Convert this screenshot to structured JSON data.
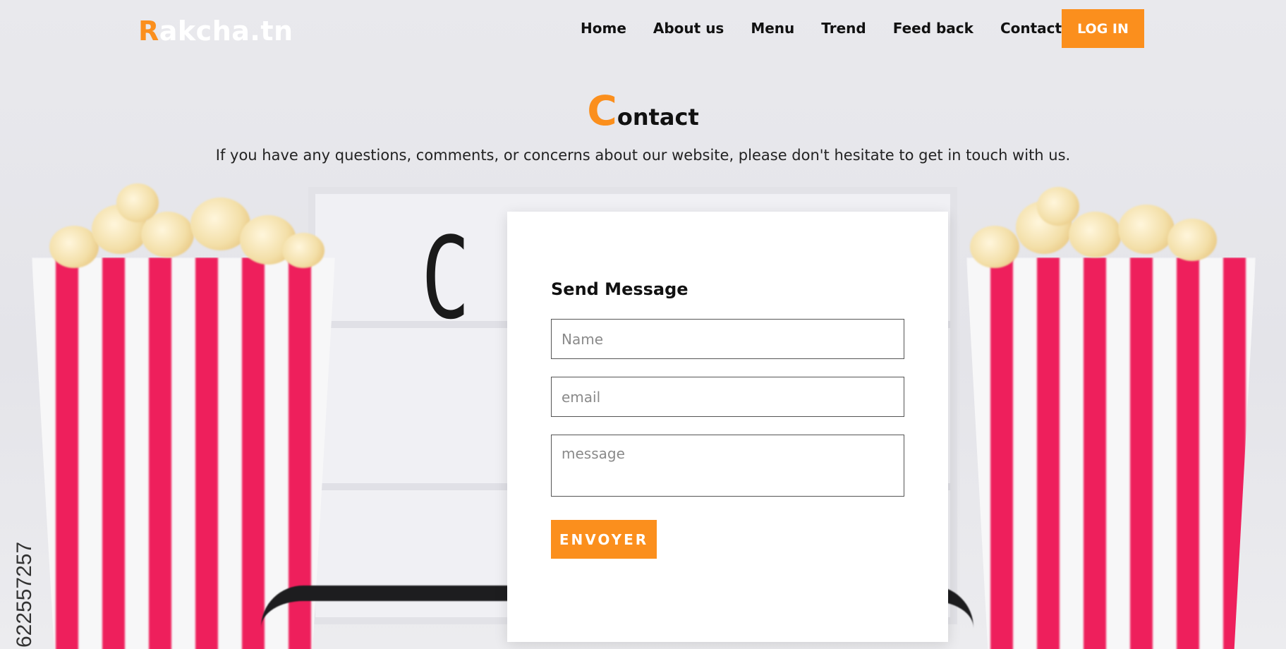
{
  "header": {
    "logo_first_letter": "R",
    "logo_rest": "akcha.tn",
    "nav": [
      {
        "label": "Home"
      },
      {
        "label": "About us"
      },
      {
        "label": "Menu"
      },
      {
        "label": "Trend"
      },
      {
        "label": "Feed back"
      },
      {
        "label": "Contact"
      }
    ],
    "login_label": "LOG IN"
  },
  "contact": {
    "title_first_letter": "C",
    "title_rest": "ontact",
    "intro": "If you have any questions, comments, or concerns about our website, please don't hesitate to get in touch with us."
  },
  "form": {
    "title": "Send Message",
    "name_placeholder": "Name",
    "name_value": "",
    "email_placeholder": "email",
    "email_value": "",
    "message_placeholder": "message",
    "message_value": "",
    "submit_label": "ENVOYER"
  },
  "background": {
    "lightbox_letter": "C",
    "stock_id": "622557257"
  },
  "colors": {
    "accent": "#fb8f1d",
    "stripe": "#ee1f5c",
    "card": "#ffffff",
    "text": "#111111"
  }
}
